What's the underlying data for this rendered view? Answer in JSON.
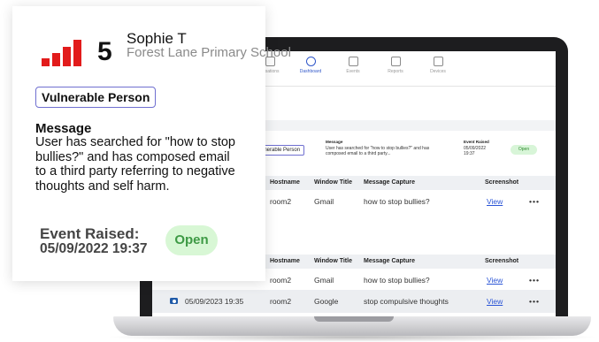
{
  "nav": {
    "items": [
      {
        "label": "...isations"
      },
      {
        "label": "Dashboard"
      },
      {
        "label": "Events"
      },
      {
        "label": "Reports"
      },
      {
        "label": "Devices"
      }
    ]
  },
  "event_summary": {
    "chip": "lnerable Person",
    "message_title": "Message",
    "message_line1": "User has searched for \"how to stop bullies?\" and has",
    "message_line2": "composed email to a third party...",
    "raised_title": "Event Raised",
    "raised_date": "05/09/2022",
    "raised_time": "19:37",
    "status": "Open"
  },
  "table1": {
    "headers": [
      "Hostname",
      "Window Title",
      "Message Capture",
      "Screenshot"
    ],
    "rows": [
      {
        "hostname": "room2",
        "window": "Gmail",
        "capture": "how to stop bullies?",
        "screenshot": "View",
        "more": "•••"
      }
    ]
  },
  "table2": {
    "headers": [
      "Hostname",
      "Window Title",
      "Message Capture",
      "Screenshot"
    ],
    "rows": [
      {
        "datetime": "",
        "hostname": "room2",
        "window": "Gmail",
        "capture": "how to stop bullies?",
        "screenshot": "View",
        "more": "•••"
      },
      {
        "datetime": "05/09/2023 19:35",
        "hostname": "room2",
        "window": "Google",
        "capture": "stop compulsive thoughts",
        "screenshot": "View",
        "more": "•••"
      }
    ]
  },
  "card": {
    "risk_level": "5",
    "name": "Sophie T",
    "school": "Forest Lane Primary School",
    "category": "Vulnerable Person",
    "message_title": "Message",
    "message": "User has searched for \"how to stop bullies?\" and has composed email to a third party referring to negative thoughts and self harm.",
    "raised_label": "Event Raised:",
    "raised_value": "05/09/2022 19:37",
    "status": "Open"
  },
  "colors": {
    "risk": "#e21b1b",
    "accent": "#3057c9",
    "open_bg": "#d8f7d5",
    "open_text": "#3e9a45"
  }
}
